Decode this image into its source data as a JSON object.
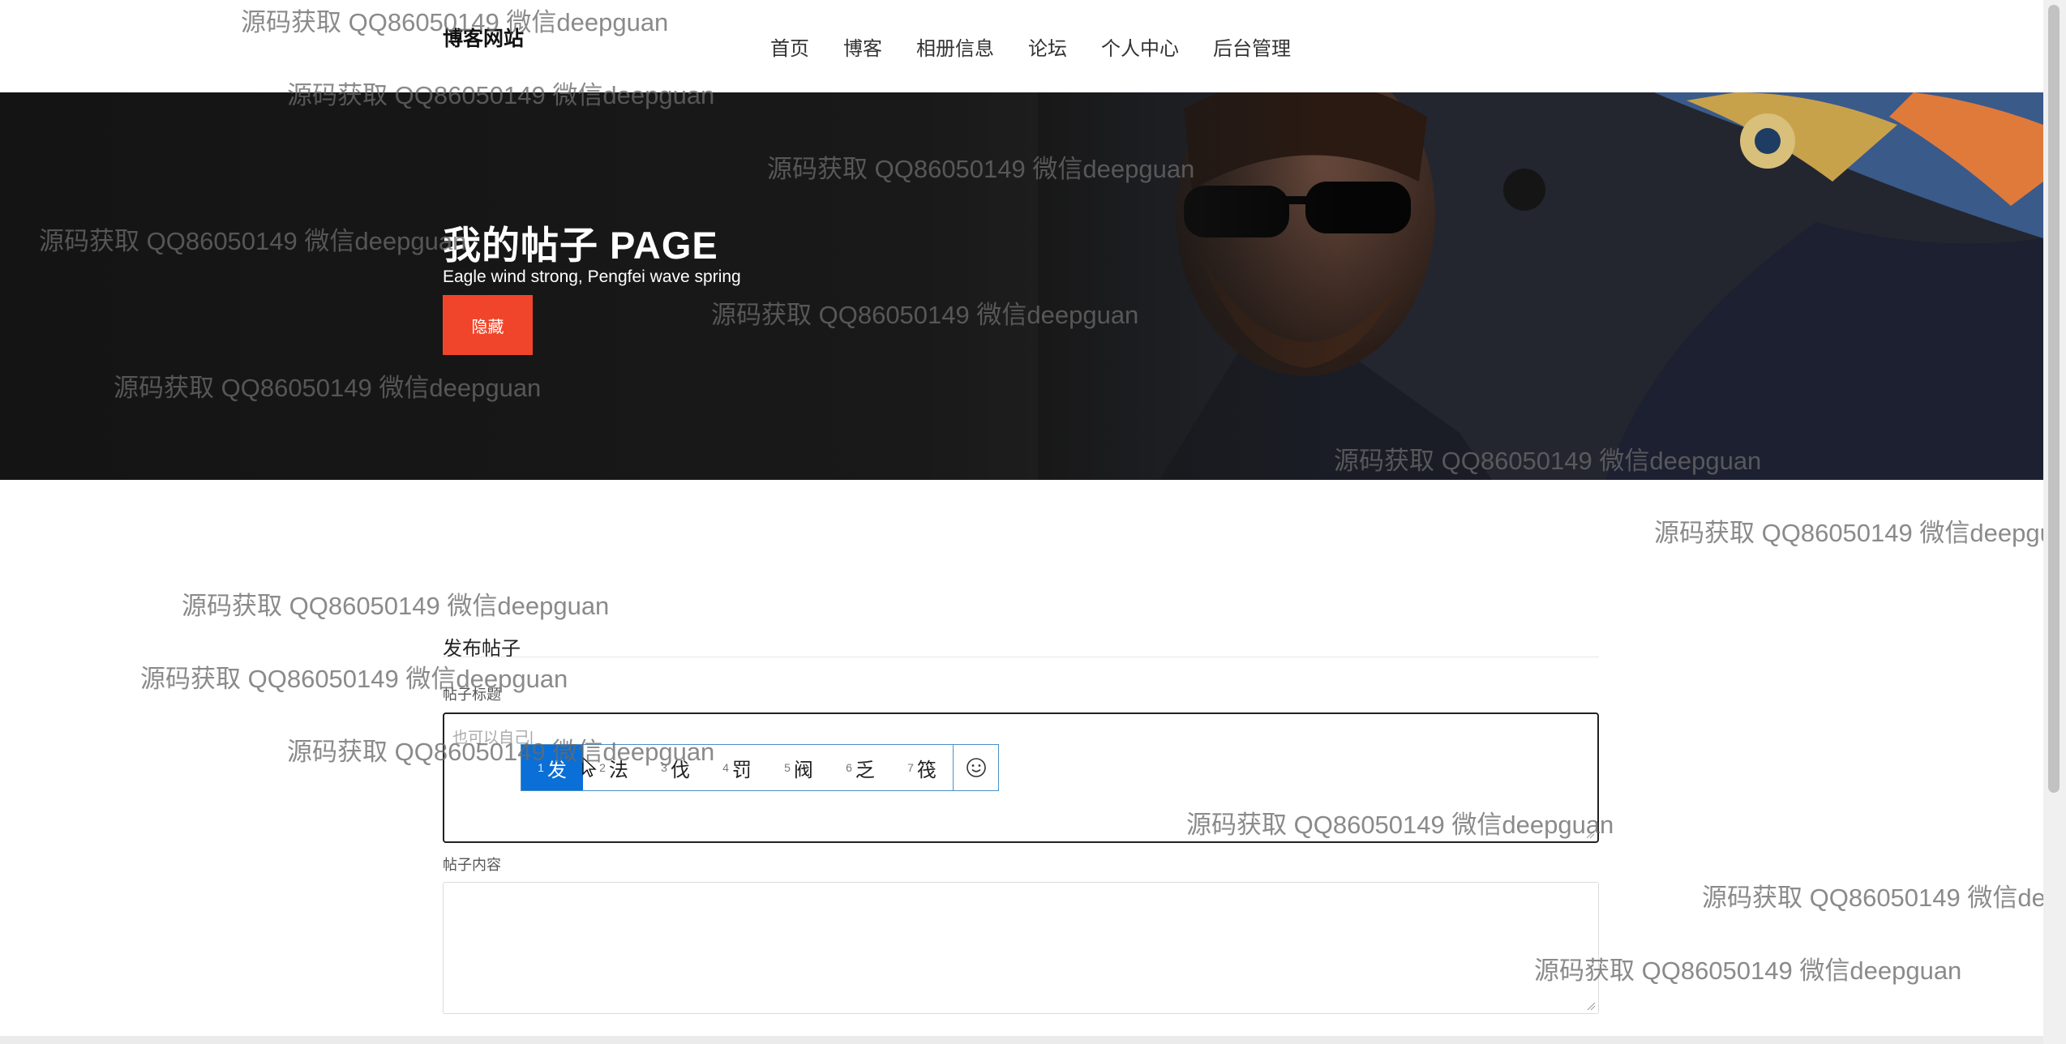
{
  "header": {
    "brand": "博客网站",
    "nav": [
      "首页",
      "博客",
      "相册信息",
      "论坛",
      "个人中心",
      "后台管理"
    ]
  },
  "hero": {
    "title": "我的帖子 PAGE",
    "subtitle": "Eagle wind strong, Pengfei wave spring",
    "button_label": "隐藏"
  },
  "form": {
    "section_title": "发布帖子",
    "title_label": "帖子标题",
    "title_value": "也可以自己|",
    "content_label": "帖子内容",
    "content_value": ""
  },
  "ime": {
    "candidates": [
      {
        "num": "1",
        "text": "发"
      },
      {
        "num": "2",
        "text": "法"
      },
      {
        "num": "3",
        "text": "伐"
      },
      {
        "num": "4",
        "text": "罚"
      },
      {
        "num": "5",
        "text": "阀"
      },
      {
        "num": "6",
        "text": "乏"
      },
      {
        "num": "7",
        "text": "筏"
      }
    ],
    "selected_index": 0,
    "emoji_icon": "smiley-face-icon"
  },
  "watermark": "源码获取 QQ86050149 微信deepguan",
  "colors": {
    "accent": "#f0452a",
    "ime_selected": "#0a6fd6",
    "hero_bg": "#141414"
  }
}
